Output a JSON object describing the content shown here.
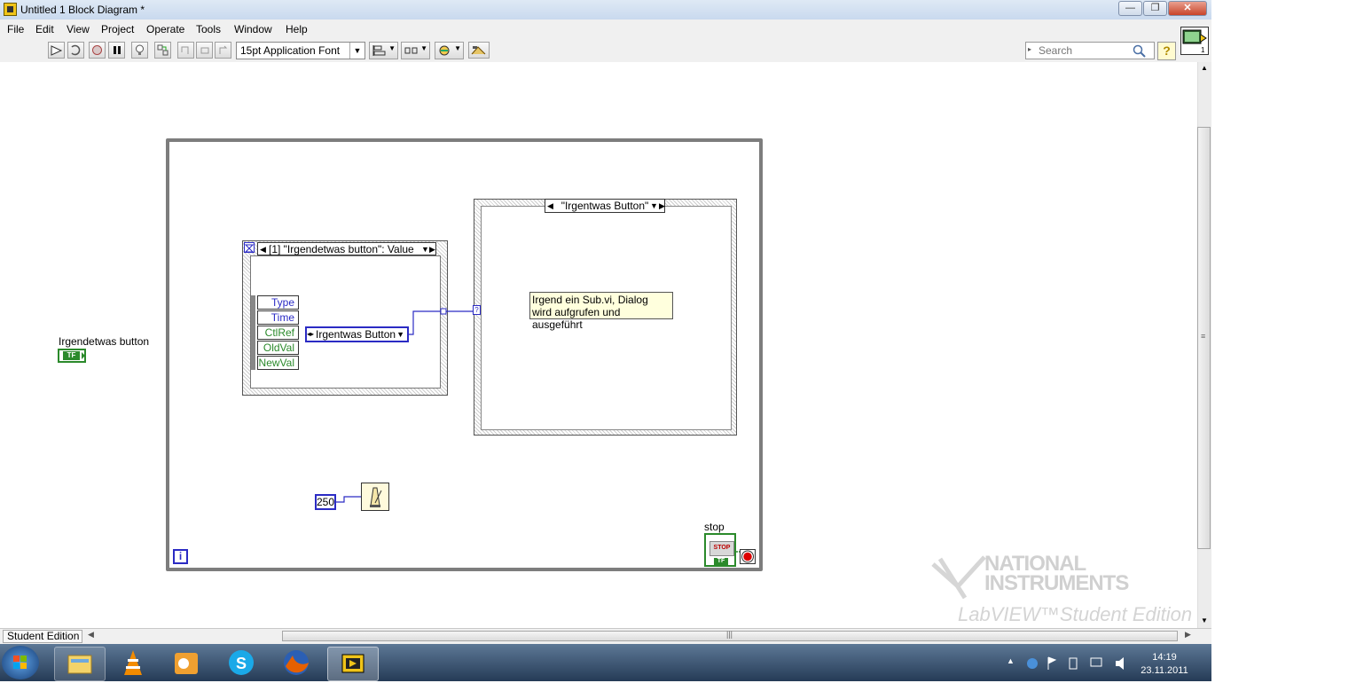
{
  "window": {
    "title": "Untitled 1 Block Diagram *",
    "controls": [
      "minimize",
      "maximize",
      "close"
    ]
  },
  "menu": {
    "items": [
      "File",
      "Edit",
      "View",
      "Project",
      "Operate",
      "Tools",
      "Window",
      "Help"
    ]
  },
  "toolbar": {
    "font_select": "15pt Application Font",
    "search_placeholder": "Search",
    "help_label": "?"
  },
  "diagram": {
    "control_label": "Irgendetwas button",
    "control_term": "TF",
    "event_selector": "[1] \"Irgendetwas button\": Value",
    "event_data": [
      "Type",
      "Time",
      "CtlRef",
      "OldVal",
      "NewVal"
    ],
    "enum_value": "Irgentwas Button",
    "case_selector": "\"Irgentwas Button\"",
    "comment": "Irgend ein Sub.vi, Dialog wird aufgrufen und ausgeführt",
    "wait_constant": "250",
    "iteration_label": "i",
    "stop_label": "stop",
    "stop_button": "STOP",
    "stop_term": "TF"
  },
  "status": {
    "edition": "Student Edition"
  },
  "watermark": {
    "brand": "NATIONAL INSTRUMENTS",
    "product": "LabVIEW™Student Edition"
  },
  "taskbar": {
    "time": "14:19",
    "date": "23.11.2011",
    "apps": [
      "Explorer",
      "VLC",
      "Outlook",
      "Skype",
      "Firefox",
      "LabVIEW"
    ]
  },
  "colors": {
    "loop_border": "#7d7d7d",
    "numeric_blue": "#2b2bc4",
    "boolean_green": "#2b8a2b",
    "comment_bg": "#ffffdd"
  }
}
